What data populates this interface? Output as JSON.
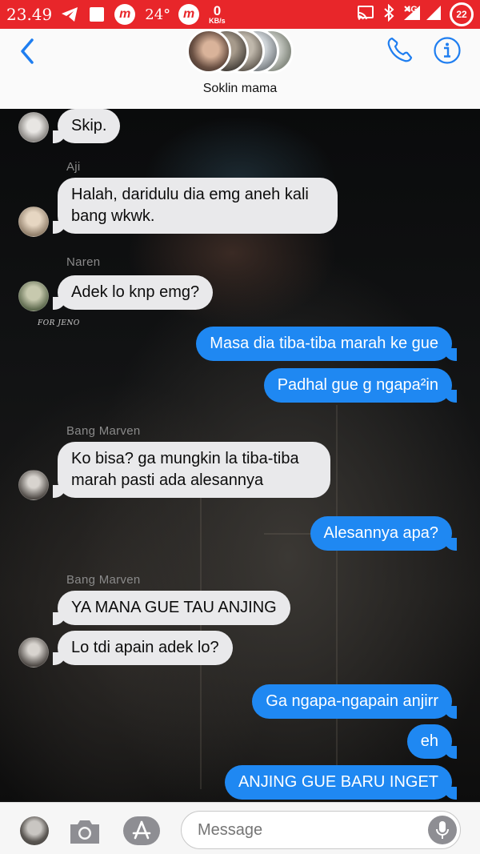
{
  "status_bar": {
    "time": "23.49",
    "temperature": "24°",
    "net_speed_value": "0",
    "net_speed_unit": "KB/s",
    "network_type": "4G",
    "battery": "22"
  },
  "header": {
    "group_name": "Soklin mama"
  },
  "messages": [
    {
      "sender": "",
      "text": "Skip.",
      "direction": "in"
    },
    {
      "sender": "Aji",
      "text": "Halah, daridulu dia emg aneh kali bang wkwk.",
      "direction": "in"
    },
    {
      "sender": "Naren",
      "text": "Adek lo knp emg?",
      "direction": "in",
      "avatar_caption": "FOR JENO"
    },
    {
      "sender": "",
      "text": "Masa dia tiba-tiba marah ke gue",
      "direction": "out"
    },
    {
      "sender": "",
      "text": "Padhal gue g ngapa²in",
      "direction": "out"
    },
    {
      "sender": "Bang Marven",
      "text": "Ko bisa? ga mungkin la tiba-tiba marah pasti ada alesannya",
      "direction": "in"
    },
    {
      "sender": "",
      "text": "Alesannya apa?",
      "direction": "out"
    },
    {
      "sender": "Bang Marven",
      "text": "YA MANA GUE TAU ANJING",
      "direction": "in"
    },
    {
      "sender": "",
      "text": "Lo tdi apain adek lo?",
      "direction": "in"
    },
    {
      "sender": "",
      "text": "Ga ngapa-ngapain anjirr",
      "direction": "out"
    },
    {
      "sender": "",
      "text": "eh",
      "direction": "out"
    },
    {
      "sender": "",
      "text": "ANJING GUE BARU INGET",
      "direction": "out"
    }
  ],
  "composer": {
    "placeholder": "Message"
  },
  "colors": {
    "status_bar": "#e8262a",
    "outgoing_bubble": "#1f88f2",
    "incoming_bubble": "#e9e9eb",
    "accent": "#1f6fe0"
  }
}
